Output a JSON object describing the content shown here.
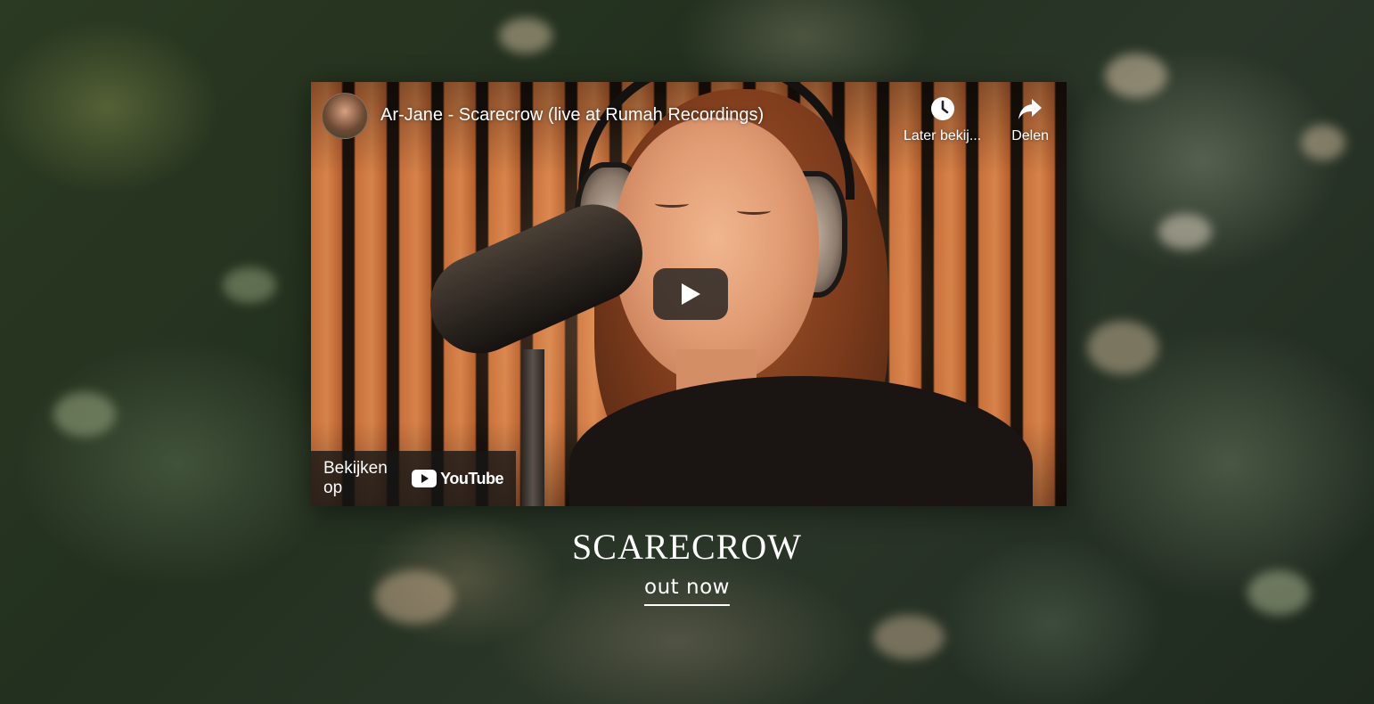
{
  "video": {
    "title": "Ar-Jane - Scarecrow (live at Rumah Recordings)",
    "watch_later_label": "Later bekij...",
    "share_label": "Delen",
    "watch_on_label": "Bekijken op",
    "youtube_wordmark": "YouTube",
    "icons": {
      "watch_later": "clock-icon",
      "share": "share-arrow-icon",
      "play": "play-icon",
      "youtube": "youtube-logo-icon"
    }
  },
  "release": {
    "title": "SCARECROW",
    "link_label": "out now"
  },
  "colors": {
    "text": "#ffffff",
    "play_button_bg": "#212121",
    "youtube_red": "#ffffff"
  }
}
